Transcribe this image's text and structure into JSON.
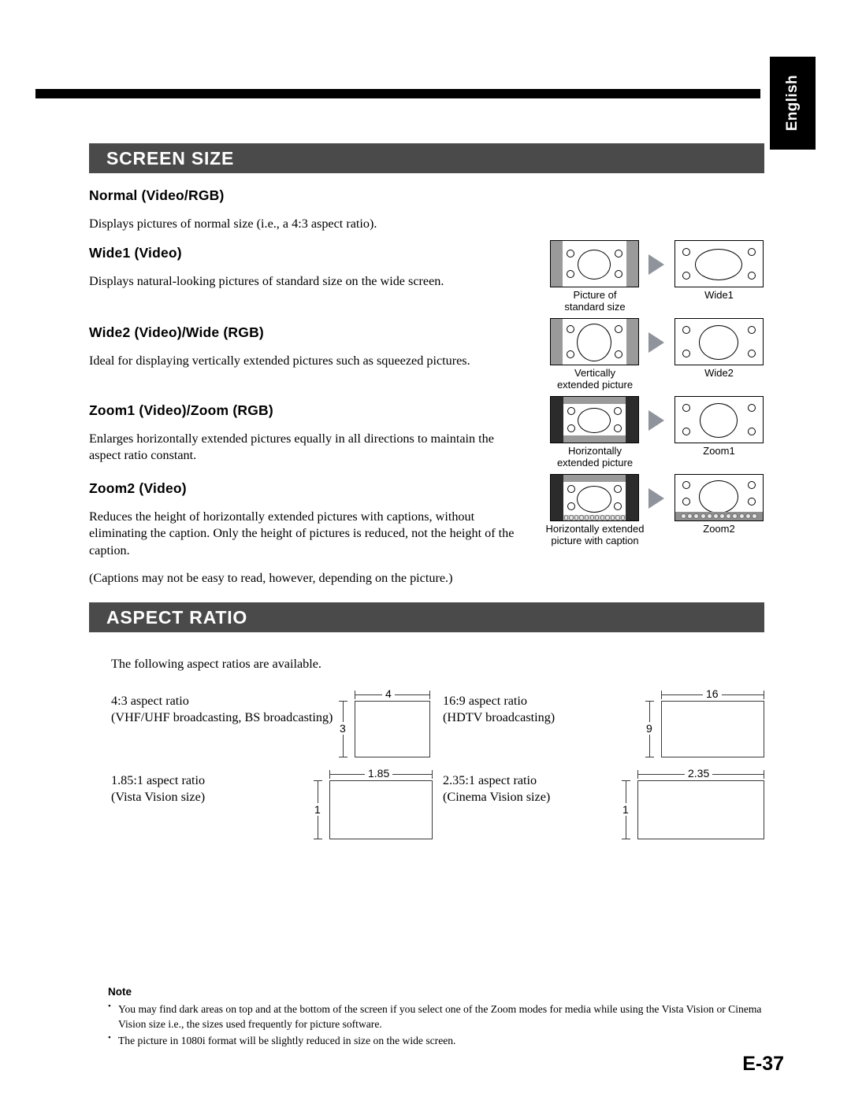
{
  "language_tab": "English",
  "page_number": "E-37",
  "sections": [
    {
      "id": "screen-size",
      "banner": "SCREEN SIZE",
      "entries": [
        {
          "heading": "Normal (Video/RGB)",
          "lines": [
            "Displays pictures of normal size (i.e., a 4:3 aspect ratio)."
          ]
        },
        {
          "heading": "Wide1 (Video)",
          "lines": [
            "Displays natural-looking pictures of standard size on the wide screen."
          ]
        },
        {
          "heading": "Wide2 (Video)/Wide (RGB)",
          "lines": [
            "Ideal for displaying vertically extended pictures such as squeezed pictures."
          ]
        },
        {
          "heading": "Zoom1 (Video)/Zoom (RGB)",
          "lines": [
            "Enlarges horizontally extended pictures equally in all directions to maintain the aspect ratio constant."
          ]
        },
        {
          "heading": "Zoom2 (Video)",
          "lines": [
            "Reduces the height of horizontally extended pictures with captions, without eliminating the caption.  Only the height of pictures is reduced, not the height of the caption.",
            "(Captions may not be easy to read, however, depending on the picture.)"
          ]
        }
      ]
    },
    {
      "id": "aspect-ratio",
      "banner": "ASPECT RATIO",
      "intro": "The following aspect ratios are available."
    }
  ],
  "illustrations": [
    {
      "source_label_line1": "Picture of",
      "source_label_line2": "standard size",
      "result_label": "Wide1"
    },
    {
      "source_label_line1": "Vertically",
      "source_label_line2": "extended picture",
      "result_label": "Wide2"
    },
    {
      "source_label_line1": "Horizontally",
      "source_label_line2": "extended picture",
      "result_label": "Zoom1"
    },
    {
      "source_label_line1": "Horizontally extended",
      "source_label_line2": "picture with caption",
      "result_label": "Zoom2"
    }
  ],
  "aspect_ratios": [
    {
      "title": "4:3 aspect ratio",
      "subtitle": "(VHF/UHF broadcasting, BS broadcasting)",
      "width_label": "4",
      "height_label": "3"
    },
    {
      "title": "16:9 aspect ratio",
      "subtitle": "(HDTV broadcasting)",
      "width_label": "16",
      "height_label": "9"
    },
    {
      "title": "1.85:1 aspect ratio",
      "subtitle": "(Vista Vision size)",
      "width_label": "1.85",
      "height_label": "1"
    },
    {
      "title": "2.35:1 aspect ratio",
      "subtitle": "(Cinema Vision size)",
      "width_label": "2.35",
      "height_label": "1"
    }
  ],
  "note": {
    "title": "Note",
    "items": [
      "You may find dark areas on top and at the bottom of the screen if you select one of the Zoom modes for media while using the Vista Vision or Cinema Vision size i.e., the sizes used frequently for picture software.",
      "The picture in 1080i format will be slightly reduced in size on the wide screen."
    ]
  },
  "colors": {
    "banner_bg": "#4a4a4a",
    "tab_bg": "#000000",
    "mask_gray": "#9a9a9a",
    "mask_black": "#2b2b2b",
    "arrow": "#8f939c"
  }
}
